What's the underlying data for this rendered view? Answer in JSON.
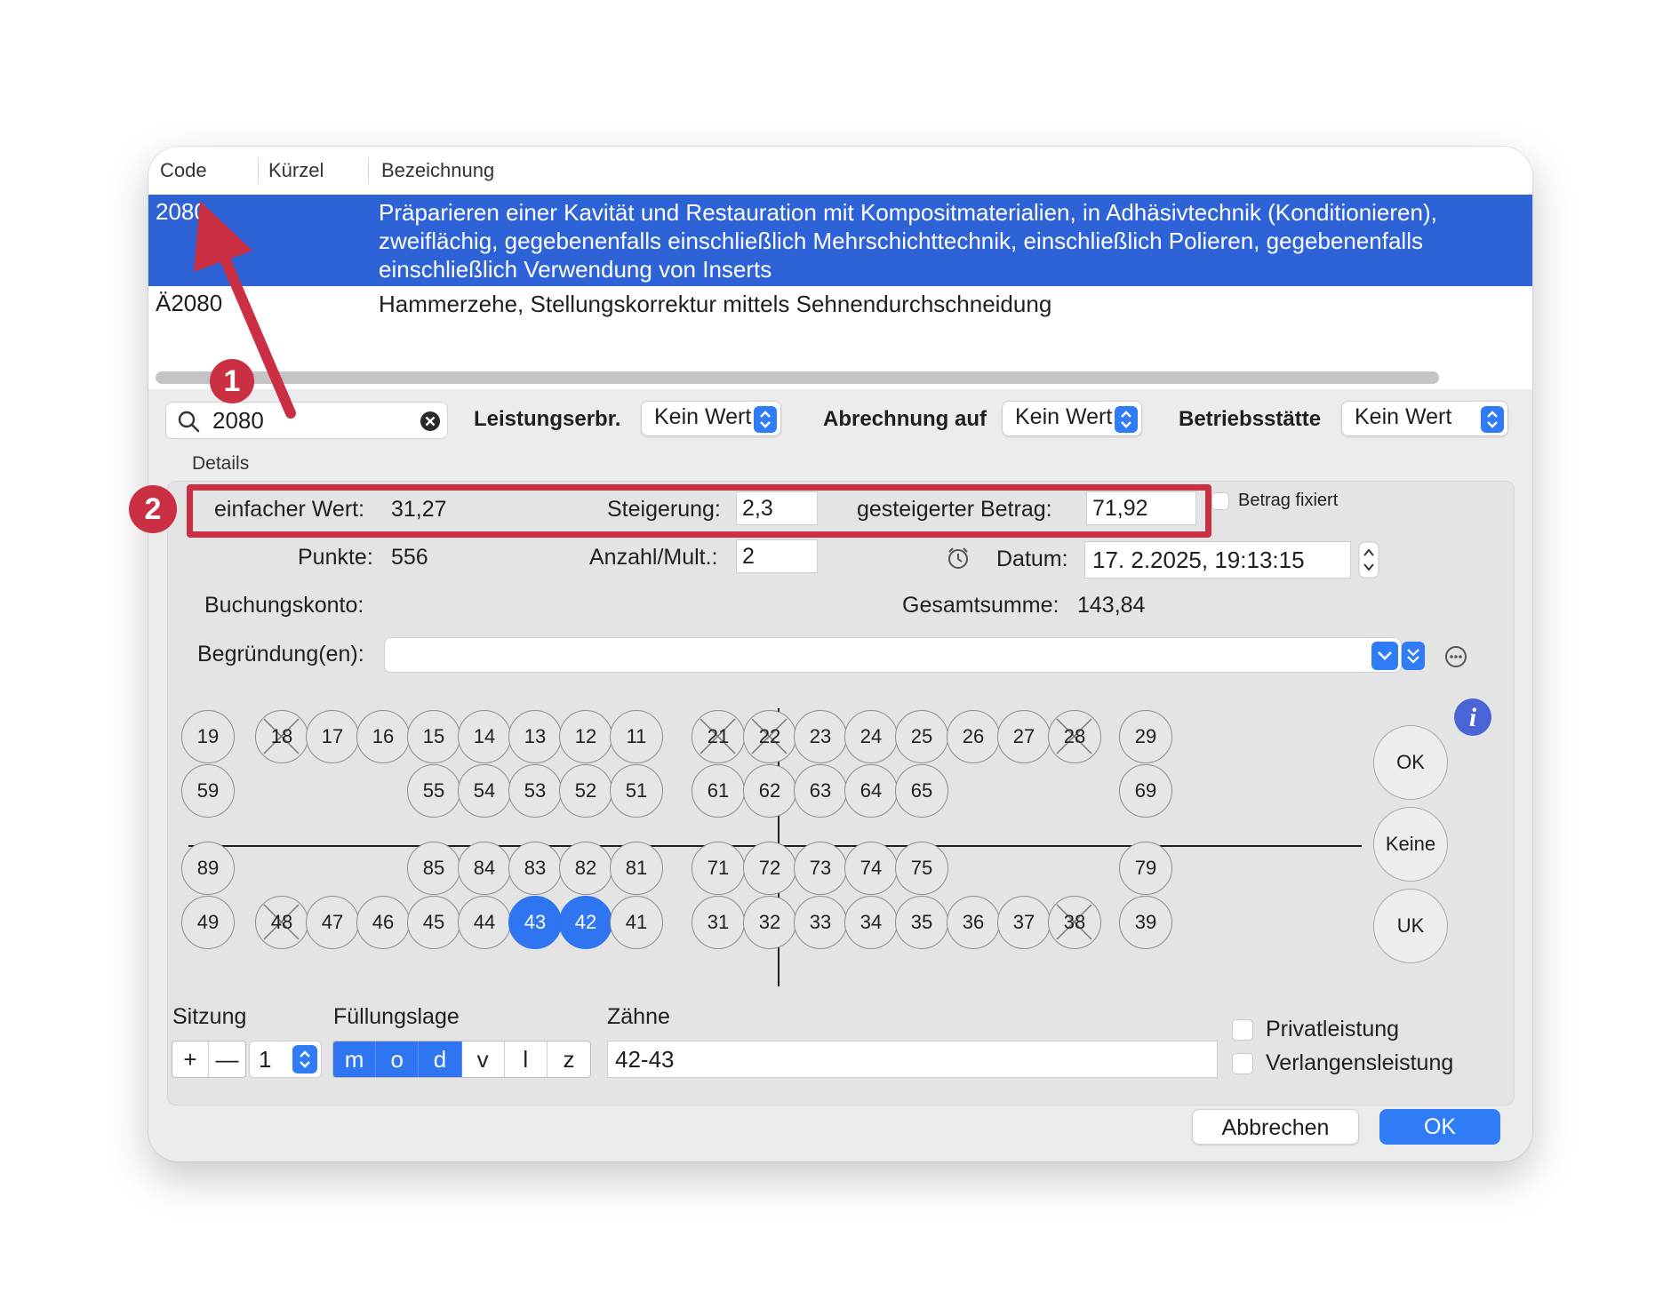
{
  "table": {
    "columns": [
      "Code",
      "Kürzel",
      "Bezeichnung"
    ],
    "rows": [
      {
        "code": "2080",
        "kuerzel": "",
        "desc_lines": [
          "Präparieren einer Kavität und Restauration mit Kompositmaterialien, in Adhäsivtechnik (Konditionieren),",
          "zweiflächig, gegebenenfalls einschließlich Mehrschichttechnik, einschließlich Polieren, gegebenenfalls",
          "einschließlich Verwendung von Inserts"
        ]
      },
      {
        "code": "Ä2080",
        "kuerzel": "",
        "desc_lines": [
          "Hammerzehe, Stellungskorrektur mittels Sehnendurchschneidung"
        ]
      }
    ]
  },
  "search": {
    "value": "2080"
  },
  "filters": {
    "leistungserbr_label": "Leistungserbr.",
    "leistungserbr_value": "Kein Wert",
    "abrechnung_label": "Abrechnung auf",
    "abrechnung_value": "Kein Wert",
    "betriebsstaette_label": "Betriebsstätte",
    "betriebsstaette_value": "Kein Wert"
  },
  "details": {
    "caption": "Details",
    "einfacher_wert_label": "einfacher Wert:",
    "einfacher_wert": "31,27",
    "steigerung_label": "Steigerung:",
    "steigerung": "2,3",
    "gesteigerter_label": "gesteigerter Betrag:",
    "gesteigerter": "71,92",
    "betrag_fixiert_label": "Betrag fixiert",
    "punkte_label": "Punkte:",
    "punkte": "556",
    "anzahl_label": "Anzahl/Mult.:",
    "anzahl": "2",
    "datum_label": "Datum:",
    "datum": "17.  2.2025, 19:13:15",
    "buchungskonto_label": "Buchungskonto:",
    "gesamtsumme_label": "Gesamtsumme:",
    "gesamtsumme": "143,84",
    "begruendung_label": "Begründung(en):"
  },
  "teeth": {
    "upper_right": [
      "19",
      "18",
      "17",
      "16",
      "15",
      "14",
      "13",
      "12",
      "11"
    ],
    "upper_left": [
      "21",
      "22",
      "23",
      "24",
      "25",
      "26",
      "27",
      "28",
      "29"
    ],
    "deciduous_upper_right": [
      "59",
      "55",
      "54",
      "53",
      "52",
      "51"
    ],
    "deciduous_upper_left": [
      "61",
      "62",
      "63",
      "64",
      "65",
      "69"
    ],
    "deciduous_lower_right": [
      "89",
      "85",
      "84",
      "83",
      "82",
      "81"
    ],
    "deciduous_lower_left": [
      "71",
      "72",
      "73",
      "74",
      "75",
      "79"
    ],
    "lower_right": [
      "49",
      "48",
      "47",
      "46",
      "45",
      "44",
      "43",
      "42",
      "41"
    ],
    "lower_left": [
      "31",
      "32",
      "33",
      "34",
      "35",
      "36",
      "37",
      "38",
      "39"
    ],
    "crossed": [
      "18",
      "21",
      "22",
      "28",
      "48",
      "38"
    ],
    "selected": [
      "43",
      "42"
    ]
  },
  "jaw_buttons": {
    "ok": "OK",
    "keine": "Keine",
    "uk": "UK"
  },
  "sitzung": {
    "label": "Sitzung",
    "plus": "+",
    "minus": "—",
    "value": "1"
  },
  "fuellungslage": {
    "label": "Füllungslage",
    "options": [
      "m",
      "o",
      "d",
      "v",
      "l",
      "z"
    ],
    "active": [
      "m",
      "o",
      "d"
    ]
  },
  "zaehne": {
    "label": "Zähne",
    "value": "42-43"
  },
  "options": {
    "privat": "Privatleistung",
    "verlangen": "Verlangensleistung"
  },
  "buttons": {
    "cancel": "Abbrechen",
    "ok": "OK"
  },
  "annotations": {
    "badge1": "1",
    "badge2": "2",
    "color": "#cb2f44"
  },
  "colors": {
    "selection": "#2e63d8",
    "accent": "#2f74f1"
  },
  "icons": [
    "search-icon",
    "clear-icon",
    "alarm-clock-icon",
    "more-icon",
    "info-icon",
    "chevron-down-icon",
    "updown-chevron-icon"
  ]
}
